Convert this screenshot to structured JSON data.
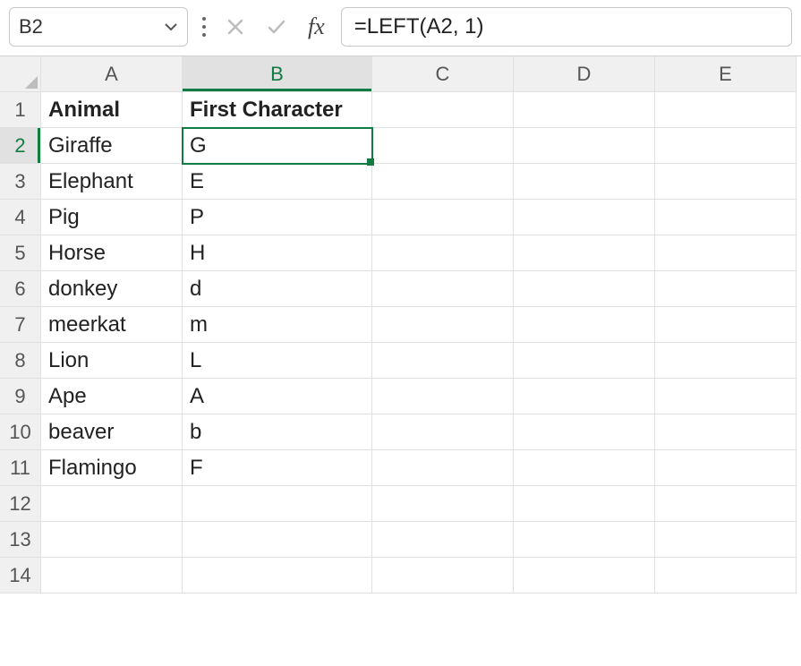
{
  "namebox": {
    "value": "B2"
  },
  "formula_bar": {
    "value": "=LEFT(A2, 1)"
  },
  "columns": [
    "A",
    "B",
    "C",
    "D",
    "E"
  ],
  "row_count": 14,
  "active": {
    "col": "B",
    "row": 2,
    "cell": "B2"
  },
  "headers": {
    "A1": "Animal",
    "B1": "First Character"
  },
  "rows": [
    {
      "a": "Giraffe",
      "b": "G"
    },
    {
      "a": "Elephant",
      "b": "E"
    },
    {
      "a": "Pig",
      "b": "P"
    },
    {
      "a": "Horse",
      "b": "H"
    },
    {
      "a": "donkey",
      "b": "d"
    },
    {
      "a": "meerkat",
      "b": "m"
    },
    {
      "a": "Lion",
      "b": "L"
    },
    {
      "a": "Ape",
      "b": "A"
    },
    {
      "a": "beaver",
      "b": "b"
    },
    {
      "a": "Flamingo",
      "b": "F"
    }
  ],
  "chart_data": {
    "type": "table",
    "columns": [
      "Animal",
      "First Character"
    ],
    "data": [
      [
        "Giraffe",
        "G"
      ],
      [
        "Elephant",
        "E"
      ],
      [
        "Pig",
        "P"
      ],
      [
        "Horse",
        "H"
      ],
      [
        "donkey",
        "d"
      ],
      [
        "meerkat",
        "m"
      ],
      [
        "Lion",
        "L"
      ],
      [
        "Ape",
        "A"
      ],
      [
        "beaver",
        "b"
      ],
      [
        "Flamingo",
        "F"
      ]
    ]
  }
}
